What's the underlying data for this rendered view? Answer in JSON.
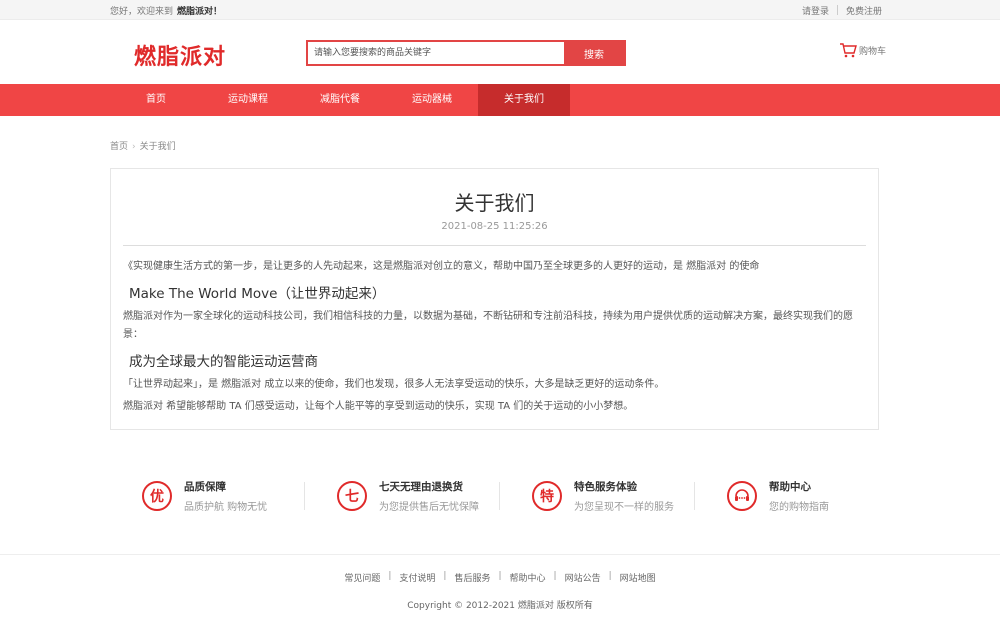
{
  "topbar": {
    "welcome": "您好，欢迎来到",
    "site_name": "燃脂派对！",
    "login": "请登录",
    "register": "免费注册"
  },
  "header": {
    "logo": "燃脂派对",
    "search_placeholder": "请输入您要搜索的商品关键字",
    "search_button": "搜索",
    "cart": "购物车"
  },
  "nav": {
    "items": [
      "首页",
      "运动课程",
      "减脂代餐",
      "运动器械",
      "关于我们"
    ]
  },
  "breadcrumb": {
    "home": "首页",
    "arrow": "›",
    "current": "关于我们"
  },
  "article": {
    "title": "关于我们",
    "date": "2021-08-25 11:25:26",
    "p1": "《实现健康生活方式的第一步，是让更多的人先动起来，这是燃脂派对创立的意义，帮助中国乃至全球更多的人更好的运动，是 燃脂派对 的使命",
    "h1": "Make The World Move（让世界动起来）",
    "p2": "燃脂派对作为一家全球化的运动科技公司，我们相信科技的力量，以数据为基础，不断钻研和专注前沿科技，持续为用户提供优质的运动解决方案，最终实现我们的愿景：",
    "h2": "成为全球最大的智能运动运营商",
    "p3": "「让世界动起来」，是 燃脂派对 成立以来的使命，我们也发现，很多人无法享受运动的快乐，大多是缺乏更好的运动条件。",
    "p4": "燃脂派对 希望能够帮助 TA 们感受运动，让每个人能平等的享受到运动的快乐，实现 TA 们的关于运动的小小梦想。"
  },
  "features": [
    {
      "icon": "优",
      "title": "品质保障",
      "desc": "品质护航 购物无忧"
    },
    {
      "icon": "七",
      "title": "七天无理由退换货",
      "desc": "为您提供售后无忧保障"
    },
    {
      "icon": "特",
      "title": "特色服务体验",
      "desc": "为您呈现不一样的服务"
    },
    {
      "icon": "help-center-icon",
      "title": "帮助中心",
      "desc": "您的购物指南"
    }
  ],
  "footer": {
    "links": [
      "常见问题",
      "支付说明",
      "售后服务",
      "帮助中心",
      "网站公告",
      "网站地图"
    ],
    "sep": "|",
    "copyright": "Copyright © 2012-2021 燃脂派对 版权所有"
  },
  "colors": {
    "accent": "#f04545",
    "nav_active": "#c62c2c",
    "logo": "#e02a2a"
  }
}
